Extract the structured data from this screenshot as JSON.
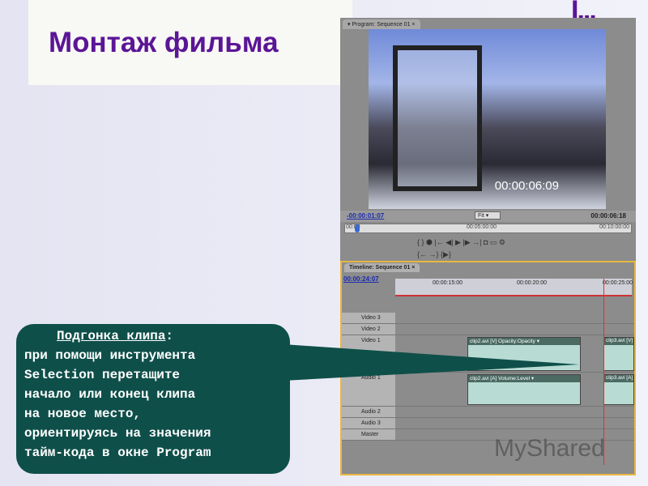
{
  "slide": {
    "title": "Монтаж фильма",
    "logo": "I..."
  },
  "program": {
    "tab": "Program: Sequence 01",
    "video_timecode": "00:00:06:09",
    "current_tc": "-00:00:01:07",
    "fit": "Fit",
    "duration_tc": "00:00:06:18",
    "ruler": [
      "00:00",
      "00:05:00:00",
      "00:10:00:00"
    ],
    "controls_row1": "{  }  ⬢   |← ◀| ▶ |▶ →|   ◘ ▭ ⚙",
    "controls_row2": "{←  →}  {▶}"
  },
  "timeline": {
    "tab": "Timeline: Sequence 01",
    "current_tc": "00:00:24:07",
    "ruler": [
      "00:00:15:00",
      "00:00:20:00",
      "00:00:25:00"
    ],
    "tracks": [
      {
        "name": "Video 3"
      },
      {
        "name": "Video 2"
      },
      {
        "name": "Video 1"
      },
      {
        "name": "Audio 1"
      },
      {
        "name": "Audio 2"
      },
      {
        "name": "Audio 3"
      },
      {
        "name": "Master"
      }
    ],
    "clips": {
      "v1a": "clip2.avi [V] Opacity:Opacity ▾",
      "v1b": "clip3.avi [V]",
      "a1a": "clip2.avi [A] Volume:Level ▾",
      "a1b": "clip3.avi [A]"
    }
  },
  "callout": {
    "heading": "Подгонка клипа",
    "lines": [
      "при помощи инструмента",
      "Selection перетащите",
      "начало или конец клипа",
      "на новое место,",
      "ориентируясь на значения",
      "тайм-кода в окне Program"
    ]
  },
  "watermark": "MyShared",
  "colors": {
    "title": "#5b1596",
    "callout": "#0f4f4a",
    "timecode": "#1a2bb0",
    "timeline_border": "#e8b840"
  }
}
